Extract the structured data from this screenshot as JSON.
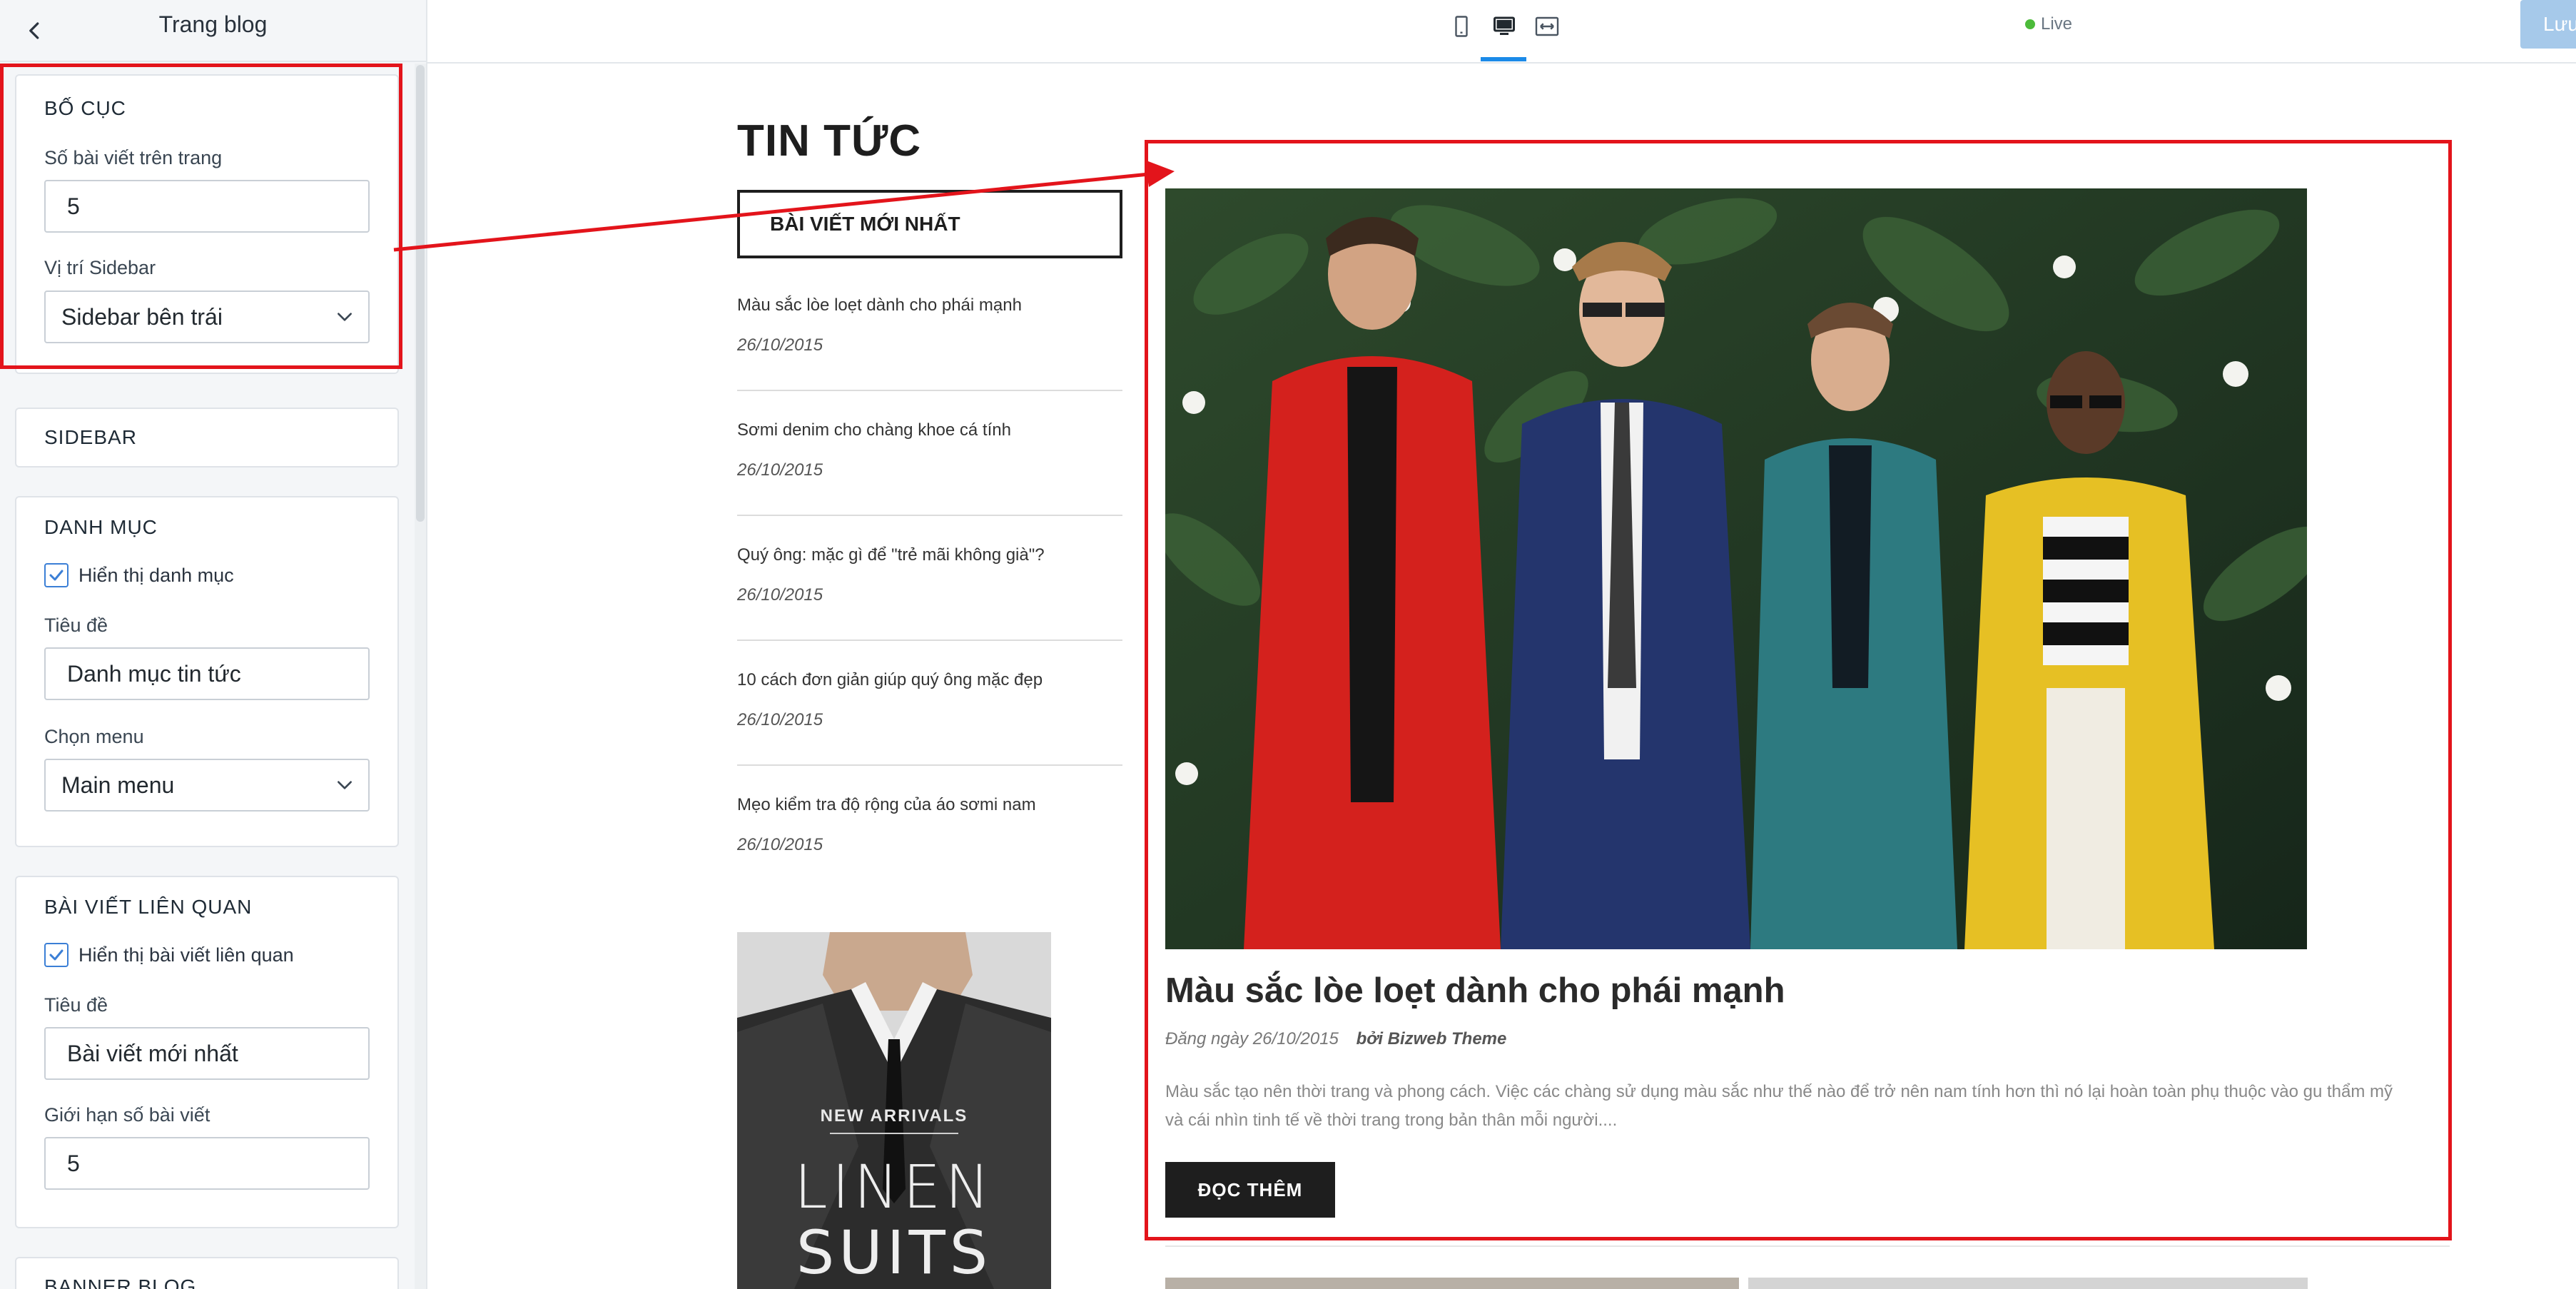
{
  "panel": {
    "title": "Trang blog",
    "back_icon": "chevron-left-icon"
  },
  "layout_section": {
    "title": "BỐ CỤC",
    "posts_per_page_label": "Số bài viết trên trang",
    "posts_per_page_value": "5",
    "sidebar_position_label": "Vị trí Sidebar",
    "sidebar_position_value": "Sidebar bên trái"
  },
  "sidebar_section": {
    "title": "SIDEBAR"
  },
  "category_section": {
    "title": "DANH MỤC",
    "show_label": "Hiển thị danh mục",
    "show_checked": true,
    "title_label": "Tiêu đề",
    "title_value": "Danh mục tin tức",
    "menu_label": "Chọn menu",
    "menu_value": "Main menu"
  },
  "related_section": {
    "title": "BÀI VIẾT LIÊN QUAN",
    "show_label": "Hiển thị bài viết liên quan",
    "show_checked": true,
    "title_label": "Tiêu đề",
    "title_value": "Bài viết mới nhất",
    "limit_label": "Giới hạn số bài viết",
    "limit_value": "5"
  },
  "banner_section": {
    "title": "BANNER BLOG"
  },
  "toolbar": {
    "devices": [
      "mobile-icon",
      "desktop-icon",
      "fullwidth-icon"
    ],
    "active_device": "desktop",
    "live_label": "Live",
    "save_label": "Lưu",
    "accent_color": "#1b8ae8",
    "live_color": "#4cbb3a"
  },
  "preview": {
    "heading": "TIN TỨC",
    "latest_label": "BÀI VIẾT MỚI NHẤT",
    "latest_posts": [
      {
        "title": "Màu sắc lòe loẹt dành cho phái mạnh",
        "date": "26/10/2015"
      },
      {
        "title": "Sơmi denim cho chàng khoe cá tính",
        "date": "26/10/2015"
      },
      {
        "title": "Quý ông: mặc gì để \"trẻ mãi không già\"?",
        "date": "26/10/2015"
      },
      {
        "title": "10 cách đơn giản giúp quý ông mặc đẹp",
        "date": "26/10/2015"
      },
      {
        "title": "Mẹo kiểm tra độ rộng của áo sơmi nam",
        "date": "26/10/2015"
      }
    ],
    "banner": {
      "line1": "NEW ARRIVALS",
      "line2": "LINEN",
      "line3": "SUITS"
    },
    "featured": {
      "title": "Màu sắc lòe loẹt dành cho phái mạnh",
      "date_prefix": "Đăng ngày",
      "date": "26/10/2015",
      "author": "bởi Bizweb Theme",
      "excerpt": "Màu sắc tạo nên thời trang và phong cách. Việc các chàng sử dụng màu sắc như thế nào để trở nên nam tính hơn thì nó lại hoàn toàn phụ thuộc vào gu thẩm mỹ và cái nhìn tinh tế về thời trang trong bản thân mỗi người....",
      "read_more": "ĐỌC THÊM"
    }
  },
  "annotation_color": "#e3141b"
}
